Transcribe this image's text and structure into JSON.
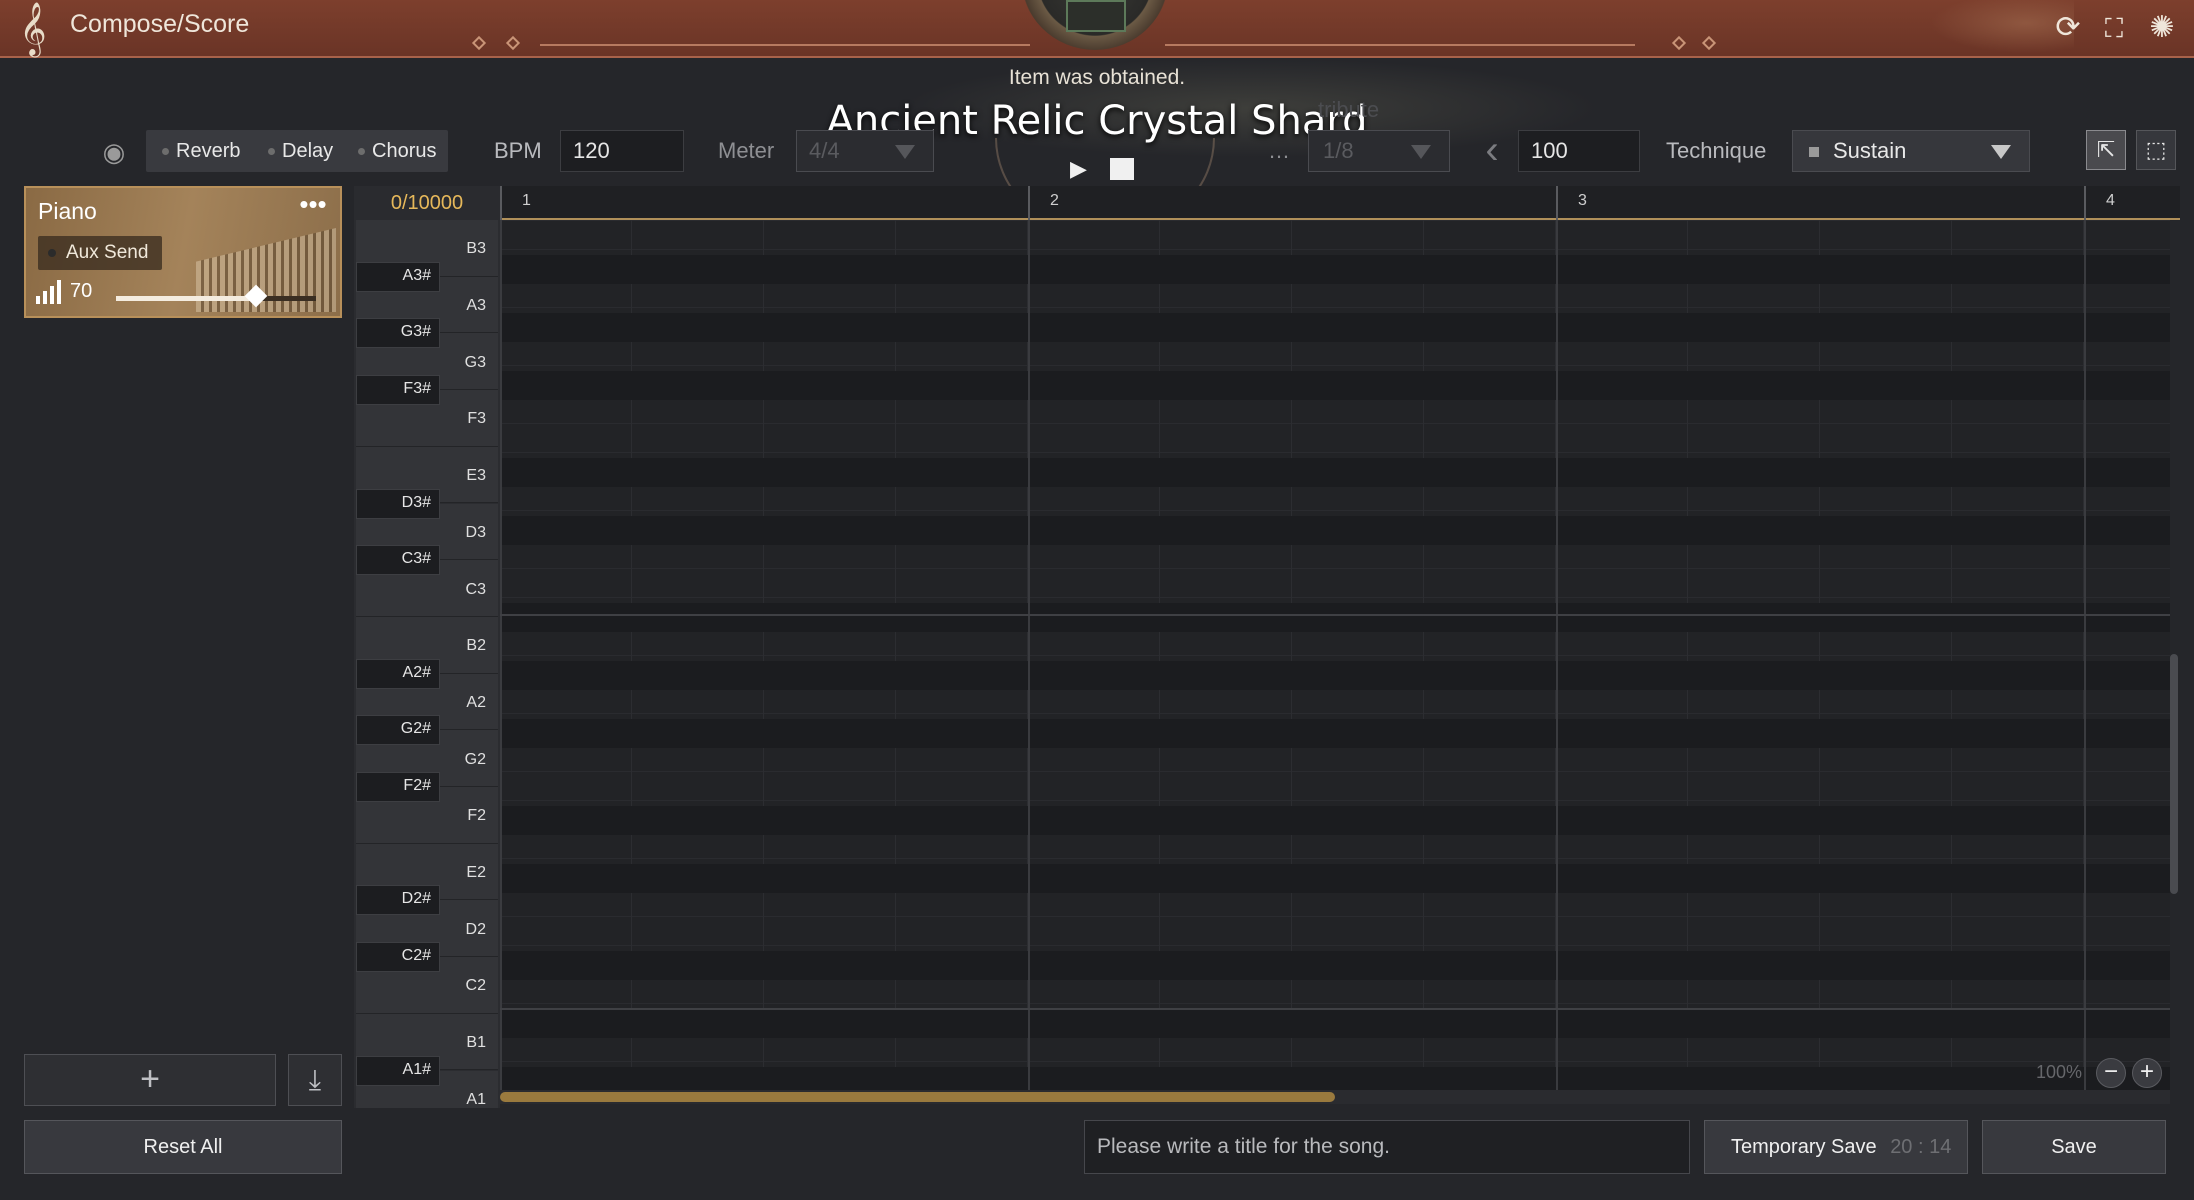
{
  "app": {
    "title": "Compose/Score",
    "clef_glyph": "𝄞"
  },
  "notification": {
    "subtitle": "Item was obtained.",
    "item_name": "Ancient Relic Crystal Shard",
    "ghost_text": "tribute"
  },
  "header_icons": [
    "refresh-icon",
    "fullscreen-icon",
    "settings-flower-icon"
  ],
  "toolbar": {
    "effects": [
      "Reverb",
      "Delay",
      "Chorus"
    ],
    "bpm_label": "BPM",
    "bpm_value": "120",
    "meter_label": "Meter",
    "meter_value": "4/4",
    "grid_label": "…",
    "grid_value": "1/8",
    "velocity_value": "100",
    "technique_label": "Technique",
    "technique_value": "Sustain",
    "tools": [
      "select-add-tool-icon",
      "marquee-select-tool-icon"
    ]
  },
  "track": {
    "name": "Piano",
    "more_label": "•••",
    "aux_send_label": "Aux Send",
    "volume": "70",
    "volume_fraction": 0.7
  },
  "roll": {
    "counter": "0/10000",
    "bars": [
      "1",
      "2",
      "3",
      "4"
    ],
    "white_keys": [
      "B3",
      "A3",
      "G3",
      "F3",
      "E3",
      "D3",
      "C3",
      "B2",
      "A2",
      "G2",
      "F2",
      "E2",
      "D2",
      "C2",
      "B1",
      "A1"
    ],
    "black_keys": [
      "A3#",
      "G3#",
      "F3#",
      "D3#",
      "C3#",
      "A2#",
      "G2#",
      "F2#",
      "D2#",
      "C2#",
      "A1#"
    ],
    "zoom": "100%",
    "horizontal_scroll_fraction": 0.5
  },
  "left_panel": {
    "add_label": "+",
    "import_label": "⤓",
    "reset_label": "Reset All"
  },
  "bottom": {
    "title_placeholder": "Please write a title for the song.",
    "temp_save_label": "Temporary Save",
    "temp_save_time": "20 : 14",
    "save_label": "Save"
  },
  "colors": {
    "accent_gold": "#b0905a",
    "counter_text": "#e6b85a",
    "header_bg": "#7d3f2d"
  }
}
